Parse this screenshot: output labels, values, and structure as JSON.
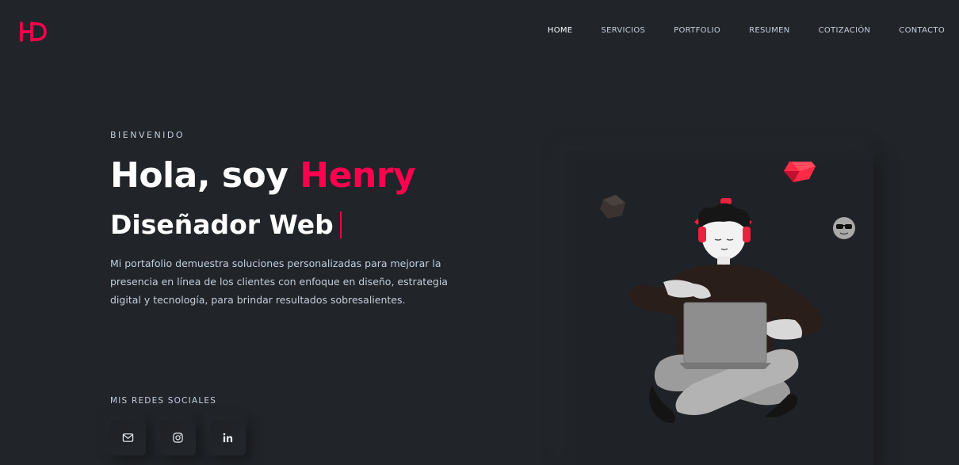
{
  "brand": {
    "logo_text": "HD",
    "accent_color": "#ff014f"
  },
  "nav": {
    "items": [
      {
        "label": "HOME",
        "active": true
      },
      {
        "label": "SERVICIOS"
      },
      {
        "label": "PORTFOLIO"
      },
      {
        "label": "RESUMEN"
      },
      {
        "label": "COTIZACIÓN"
      },
      {
        "label": "CONTACTO"
      }
    ]
  },
  "hero": {
    "eyebrow": "BIENVENIDO",
    "title_prefix": "Hola, soy ",
    "title_name": "Henry",
    "subtitle": "Diseñador Web",
    "description": "Mi portafolio demuestra soluciones personalizadas para mejorar la presencia en línea de los clientes con enfoque en diseño, estrategia digital y tecnología, para brindar resultados sobresalientes."
  },
  "social": {
    "title": "MIS REDES SOCIALES",
    "links": [
      {
        "icon": "mail-icon"
      },
      {
        "icon": "instagram-icon"
      },
      {
        "icon": "linkedin-icon"
      }
    ]
  },
  "illustration": {
    "description_icon": "person-laptop-illustration"
  }
}
